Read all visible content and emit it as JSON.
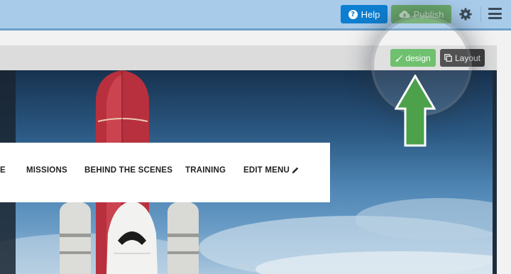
{
  "header": {
    "help_label": "Help",
    "publish_label": "Publish",
    "icons": [
      "help-circle-icon",
      "cloud-upload-icon",
      "gear-icon",
      "hamburger-menu-icon"
    ]
  },
  "editor_toolbar": {
    "design_label": "design",
    "layout_label": "Layout"
  },
  "site_nav": {
    "items": [
      "E",
      "MISSIONS",
      "BEHIND THE SCENES",
      "TRAINING",
      "EDIT MENU"
    ]
  },
  "colors": {
    "help_button": "#0d7fd1",
    "publish_button": "#6aa86a",
    "design_button": "#5cb85c",
    "layout_button": "#3b3b3b",
    "arrow": "#4ea14b"
  }
}
